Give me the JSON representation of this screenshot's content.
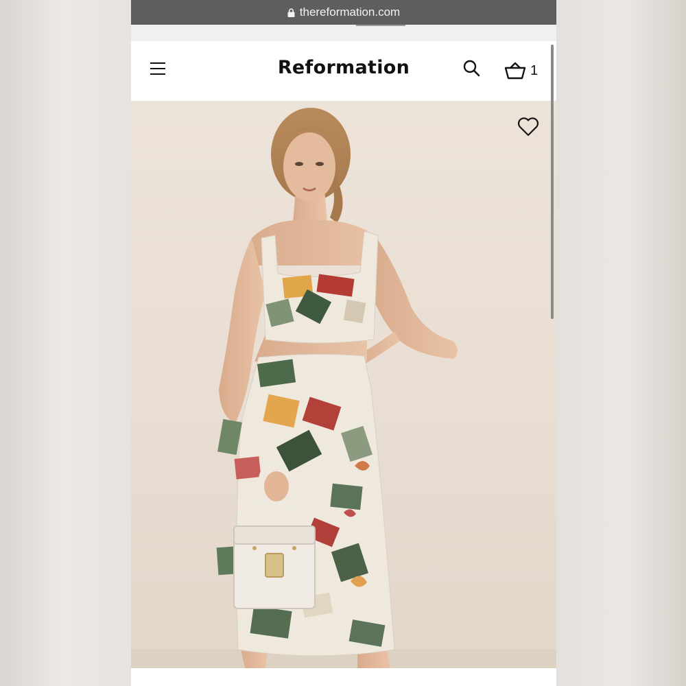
{
  "browser": {
    "url": "thereformation.com",
    "lock_icon": "lock-icon"
  },
  "header": {
    "menu_icon": "hamburger-menu-icon",
    "brand": "Reformation",
    "search_icon": "search-icon",
    "cart_icon": "shopping-basket-icon",
    "cart_count": "1"
  },
  "product_image": {
    "wishlist_icon": "heart-icon"
  },
  "colors": {
    "browser_bar": "#5e5e5e",
    "header_bg": "#ffffff",
    "brand_text": "#111111",
    "photo_backdrop": "#e9dfd4"
  }
}
